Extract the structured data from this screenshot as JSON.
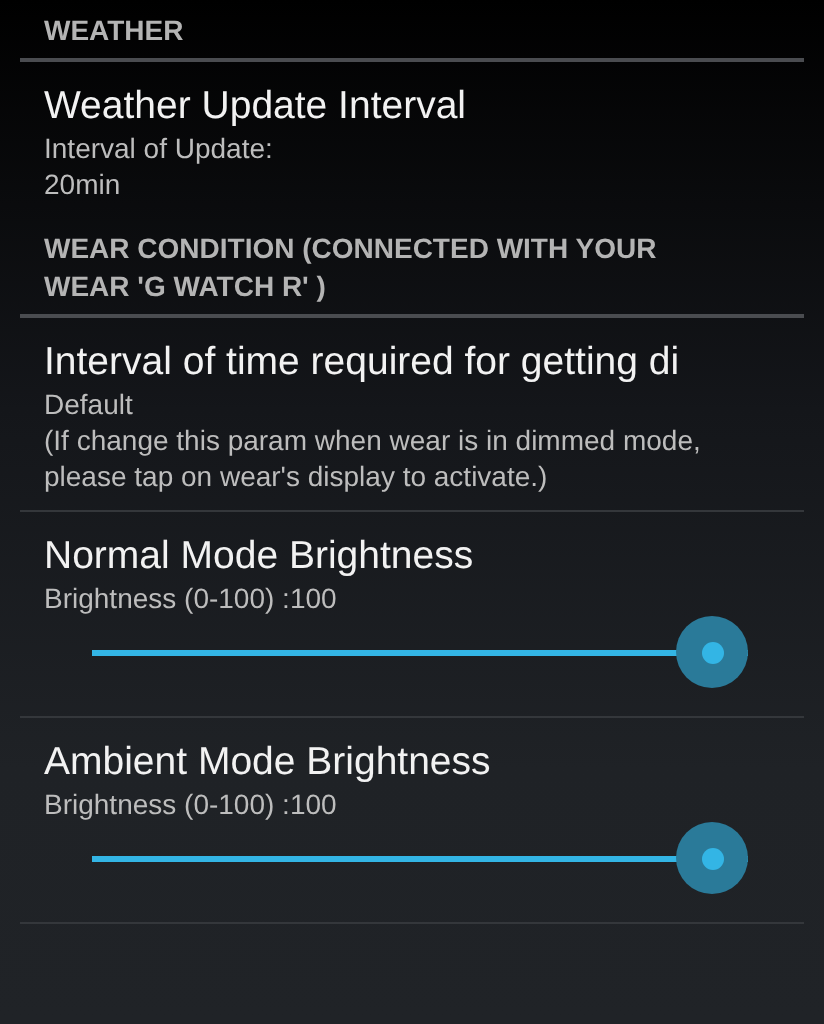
{
  "settings": [
    {
      "kind": "category",
      "label": "WEATHER"
    },
    {
      "kind": "preference",
      "title": "Weather Update Interval",
      "summary": [
        "Interval of Update:",
        "20min"
      ],
      "divider": false
    },
    {
      "kind": "category",
      "label": "WEAR CONDITION (CONNECTED WITH YOUR WEAR 'G WATCH R' )"
    },
    {
      "kind": "preference",
      "title": "Interval of time required for getting di",
      "summary": [
        "Default",
        "(If change this param when wear is in dimmed mode, please tap on wear's display to activate.)"
      ],
      "divider": true
    },
    {
      "kind": "slider",
      "title": "Normal Mode Brightness",
      "summary": [
        "Brightness (0-100) :100"
      ],
      "level": 1
    },
    {
      "kind": "slider",
      "title": "Ambient Mode Brightness",
      "summary": [
        "Brightness (0-100) :100"
      ],
      "level": 1
    }
  ]
}
